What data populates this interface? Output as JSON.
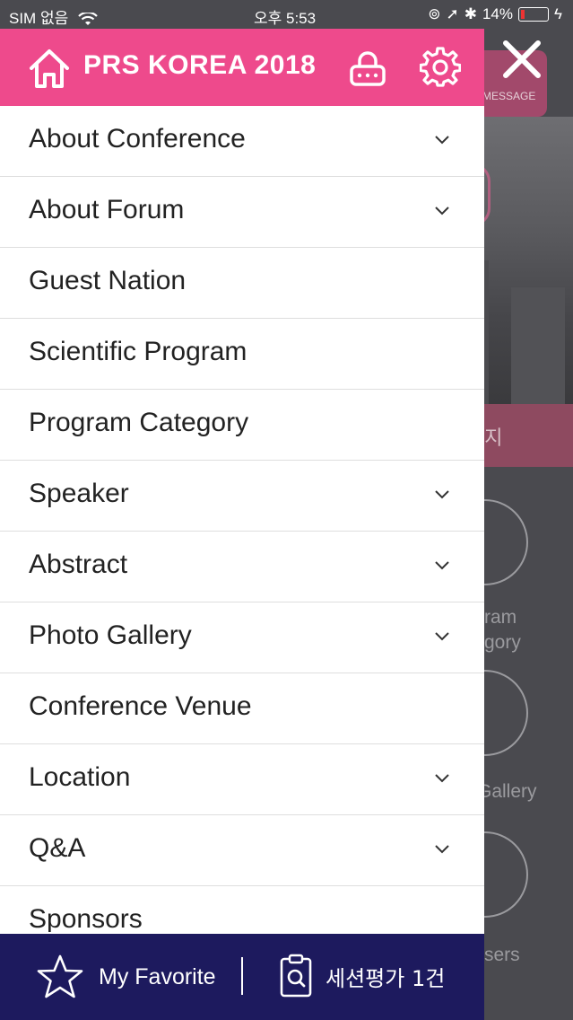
{
  "status_bar": {
    "carrier": "SIM 없음",
    "time": "오후 5:53",
    "battery": "14%"
  },
  "background": {
    "message_label": "MESSAGE",
    "banner_text": "공지",
    "labels": [
      "ram",
      "gory",
      "Gallery",
      "sers"
    ]
  },
  "drawer": {
    "title": "PRS KOREA 2018",
    "menu_items": [
      {
        "label": "About Conference",
        "expandable": true
      },
      {
        "label": "About Forum",
        "expandable": true
      },
      {
        "label": "Guest Nation",
        "expandable": false
      },
      {
        "label": "Scientific Program",
        "expandable": false
      },
      {
        "label": "Program Category",
        "expandable": false
      },
      {
        "label": "Speaker",
        "expandable": true
      },
      {
        "label": "Abstract",
        "expandable": true
      },
      {
        "label": "Photo Gallery",
        "expandable": true
      },
      {
        "label": "Conference Venue",
        "expandable": false
      },
      {
        "label": "Location",
        "expandable": true
      },
      {
        "label": "Q&A",
        "expandable": true
      },
      {
        "label": "Sponsors",
        "expandable": false
      }
    ],
    "bottom": {
      "favorite_label": "My Favorite",
      "evaluation_label": "세션평가 1건"
    }
  },
  "colors": {
    "header_pink": "#ee4a8c",
    "bottom_navy": "#1d1a5e",
    "battery_low": "#ee3333"
  },
  "icons": [
    "home-icon",
    "lock-icon",
    "gear-icon",
    "chevron-down-icon",
    "star-icon",
    "clipboard-search-icon",
    "close-icon",
    "wifi-icon",
    "battery-icon"
  ]
}
